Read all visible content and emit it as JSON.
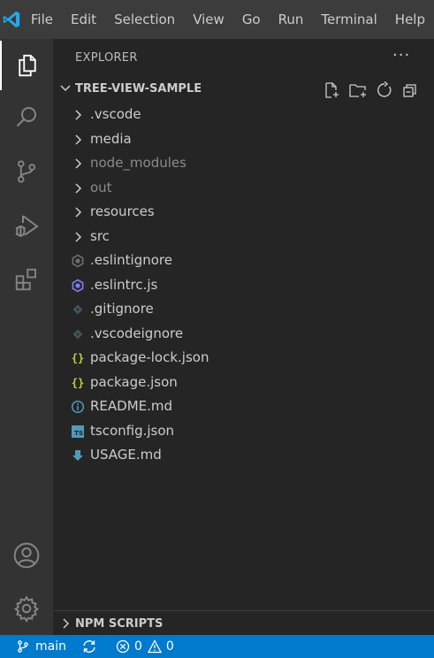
{
  "menu": {
    "items": [
      "File",
      "Edit",
      "Selection",
      "View",
      "Go",
      "Run",
      "Terminal",
      "Help"
    ]
  },
  "colors": {
    "titlebar": "#3c3c3c",
    "activitybar": "#333333",
    "sidebar": "#252526",
    "statusbar": "#007acc",
    "vscode_logo": "#23a9f2",
    "json_icon": "#cbcb41",
    "info_icon": "#519aba",
    "ts_icon": "#519aba",
    "eslint_icon": "#8080f2"
  },
  "activity_icons": [
    "explorer-icon",
    "search-icon",
    "source-control-icon",
    "run-debug-icon",
    "extensions-icon",
    "accounts-icon",
    "manage-gear-icon"
  ],
  "explorer": {
    "title": "EXPLORER",
    "more_label": "···",
    "folder_name": "TREE-VIEW-SAMPLE",
    "header_actions": [
      "new-file-icon",
      "new-folder-icon",
      "refresh-icon",
      "collapse-all-icon"
    ],
    "items": [
      {
        "label": ".vscode",
        "type": "folder",
        "dim": false
      },
      {
        "label": "media",
        "type": "folder",
        "dim": false
      },
      {
        "label": "node_modules",
        "type": "folder",
        "dim": true
      },
      {
        "label": "out",
        "type": "folder",
        "dim": true
      },
      {
        "label": "resources",
        "type": "folder",
        "dim": false
      },
      {
        "label": "src",
        "type": "folder",
        "dim": false
      },
      {
        "label": ".eslintignore",
        "type": "file",
        "icon": "eslintignore-icon",
        "dim": false
      },
      {
        "label": ".eslintrc.js",
        "type": "file",
        "icon": "eslint-icon",
        "dim": false
      },
      {
        "label": ".gitignore",
        "type": "file",
        "icon": "git-icon",
        "dim": false
      },
      {
        "label": ".vscodeignore",
        "type": "file",
        "icon": "git-icon",
        "dim": false
      },
      {
        "label": "package-lock.json",
        "type": "file",
        "icon": "json-icon",
        "dim": false
      },
      {
        "label": "package.json",
        "type": "file",
        "icon": "json-icon",
        "dim": false
      },
      {
        "label": "README.md",
        "type": "file",
        "icon": "info-icon",
        "dim": false
      },
      {
        "label": "tsconfig.json",
        "type": "file",
        "icon": "ts-icon",
        "dim": false
      },
      {
        "label": "USAGE.md",
        "type": "file",
        "icon": "markdown-download-icon",
        "dim": false
      }
    ],
    "json_glyph": "{}",
    "ts_glyph": "TS",
    "info_glyph": "i",
    "npm_section": "NPM SCRIPTS"
  },
  "statusbar": {
    "branch": "main",
    "errors": "0",
    "warnings": "0"
  }
}
